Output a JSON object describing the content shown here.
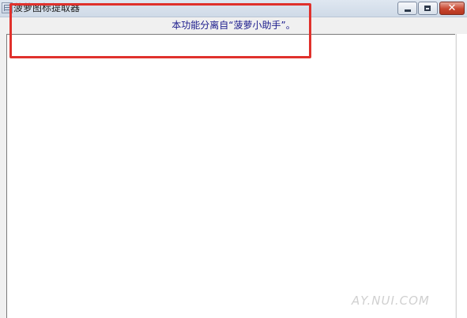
{
  "window": {
    "title": "菠萝图标提取器",
    "controls": {
      "minimize": "minimize",
      "maximize": "maximize",
      "close": "✕"
    }
  },
  "banner": {
    "text": "本功能分离自“菠萝小助手”。"
  },
  "watermark": {
    "text": "AY.NUI.COM"
  },
  "colors": {
    "banner_text": "#1a1a8c",
    "highlight": "#e0312c",
    "close_button": "#c7462f"
  },
  "icons": {
    "app": "app-icon",
    "minimize": "minimize-icon",
    "maximize": "maximize-icon",
    "close": "close-icon"
  }
}
